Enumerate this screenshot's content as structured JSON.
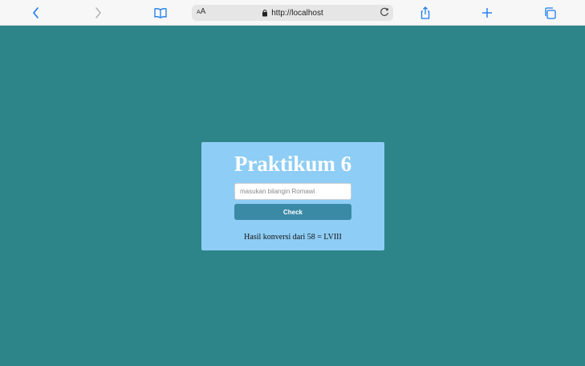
{
  "browser": {
    "url": "http://localhost",
    "text_size_label_small": "A",
    "text_size_label_large": "A",
    "accent_color": "#1a7cf0"
  },
  "page": {
    "background_color": "#2d8589",
    "card_color": "#8ecdf5",
    "title": "Praktikum 6",
    "input_placeholder": "masukan bilangin Romawi",
    "input_value": "",
    "button_label": "Check",
    "result_text": "Hasil konversi dari 58 = LVIII"
  }
}
